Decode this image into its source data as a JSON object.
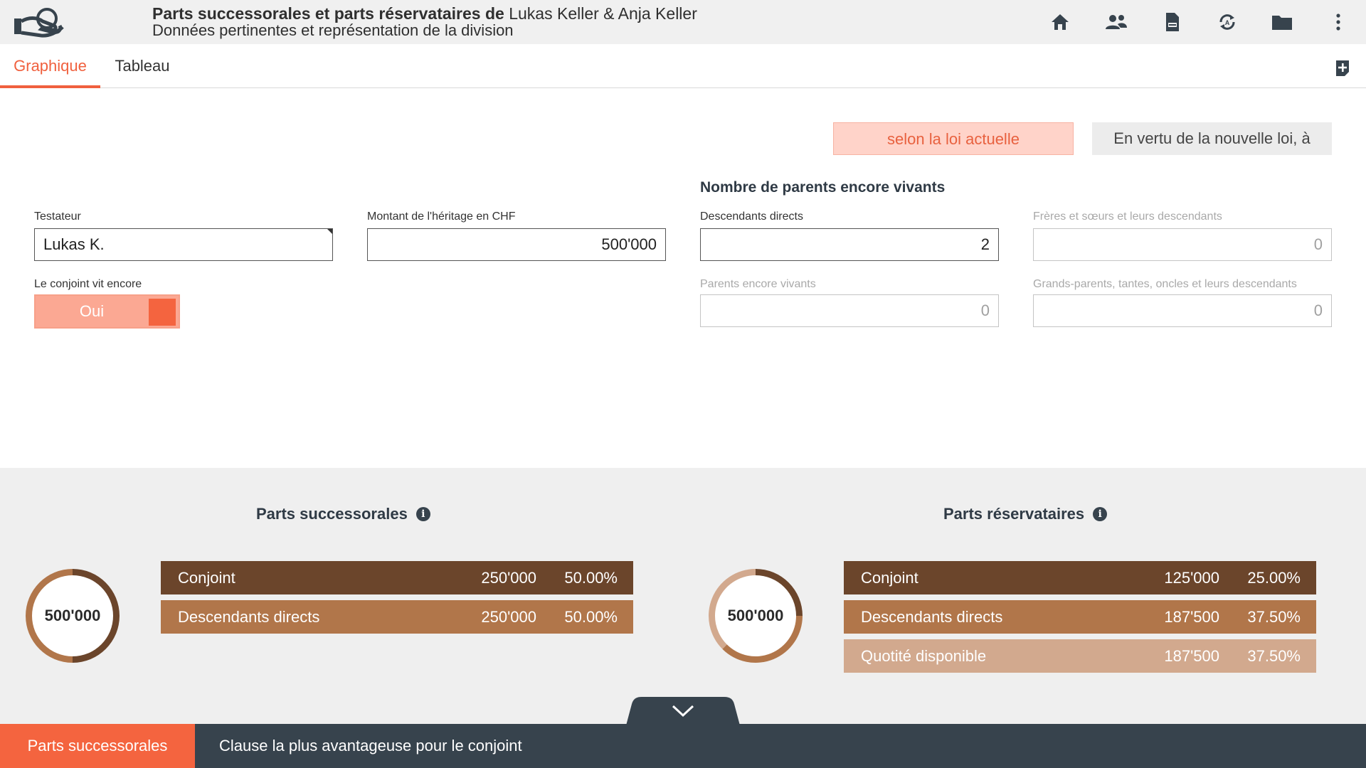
{
  "header": {
    "title_bold": "Parts successorales et parts réservataires de",
    "title_names": "Lukas Keller & Anja Keller",
    "subtitle": "Données pertinentes et représentation de la division",
    "icons": [
      "hand-logo-icon",
      "home-icon",
      "people-icon",
      "document-icon",
      "sync-icon",
      "folder-icon",
      "more-vertical-icon"
    ]
  },
  "tabs": [
    {
      "label": "Graphique",
      "active": true
    },
    {
      "label": "Tableau",
      "active": false
    }
  ],
  "law": {
    "current_label": "selon la loi actuelle",
    "new_label": "En vertu de la nouvelle loi, à"
  },
  "form": {
    "section_title": "Nombre de parents encore vivants",
    "testateur": {
      "label": "Testateur",
      "value": "Lukas K."
    },
    "montant": {
      "label": "Montant de l'héritage en CHF",
      "value": "500'000"
    },
    "conjoint": {
      "label": "Le conjoint vit encore",
      "value": "Oui"
    },
    "descendants": {
      "label": "Descendants directs",
      "value": "2"
    },
    "freres": {
      "label": "Frères et sœurs et leurs descendants",
      "value": "0"
    },
    "parents": {
      "label": "Parents encore vivants",
      "value": "0"
    },
    "grands_parents": {
      "label": "Grands-parents, tantes, oncles et leurs descendants",
      "value": "0"
    }
  },
  "results": {
    "successorales": {
      "title": "Parts successorales",
      "total": "500'000",
      "rows": [
        {
          "name": "Conjoint",
          "amount": "250'000",
          "pct": "50.00%",
          "color": "#6b452b"
        },
        {
          "name": "Descendants directs",
          "amount": "250'000",
          "pct": "50.00%",
          "color": "#b1764a"
        }
      ]
    },
    "reservataires": {
      "title": "Parts réservataires",
      "total": "500'000",
      "rows": [
        {
          "name": "Conjoint",
          "amount": "125'000",
          "pct": "25.00%",
          "color": "#6b452b"
        },
        {
          "name": "Descendants directs",
          "amount": "187'500",
          "pct": "37.50%",
          "color": "#b1764a"
        },
        {
          "name": "Quotité disponible",
          "amount": "187'500",
          "pct": "37.50%",
          "color": "#d2a98e"
        }
      ]
    }
  },
  "bottom": {
    "active_tab": "Parts successorales",
    "other_tab": "Clause la plus avantageuse pour le conjoint"
  },
  "colors": {
    "accent": "#f4643f",
    "dark": "#37434d",
    "brown_dark": "#6b452b",
    "brown_mid": "#b1764a",
    "brown_light": "#d2a98e"
  }
}
